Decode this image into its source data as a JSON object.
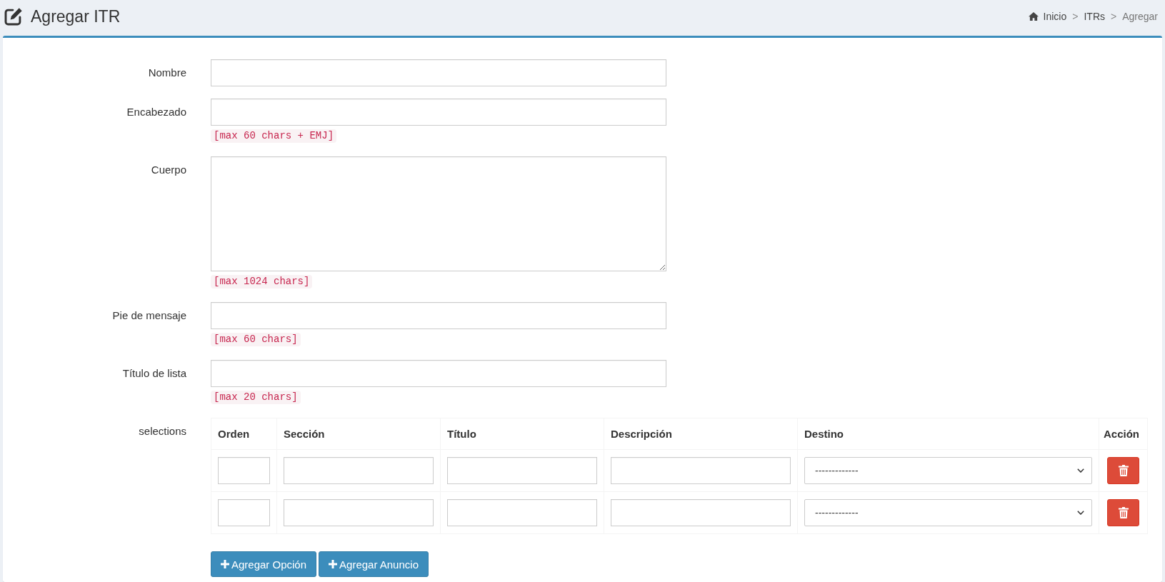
{
  "header": {
    "title": "Agregar ITR",
    "breadcrumb": [
      {
        "label": "Inicio",
        "current": false
      },
      {
        "label": "ITRs",
        "current": false
      },
      {
        "label": "Agregar",
        "current": true
      }
    ],
    "separators": [
      ">",
      ">"
    ]
  },
  "form": {
    "fields": [
      {
        "kind": "input",
        "label": "Nombre"
      },
      {
        "kind": "input",
        "label": "Encabezado",
        "hint": "[max 60 chars + EMJ]"
      },
      {
        "kind": "textarea",
        "label": "Cuerpo",
        "hint": "[max 1024 chars]"
      },
      {
        "kind": "input",
        "label": "Pie de mensaje",
        "hint": "[max 60 chars]"
      },
      {
        "kind": "input",
        "label": "Título de lista",
        "hint": "[max 20 chars]"
      }
    ],
    "selections": {
      "label": "selections",
      "columns": [
        "Orden",
        "Sección",
        "Título",
        "Descripción",
        "Destino",
        "Acción"
      ],
      "rows": [
        {
          "destino": "-------------"
        },
        {
          "destino": "-------------"
        }
      ]
    },
    "buttons": [
      {
        "label": "Agregar Opción"
      },
      {
        "label": "Agregar Anuncio"
      }
    ]
  }
}
